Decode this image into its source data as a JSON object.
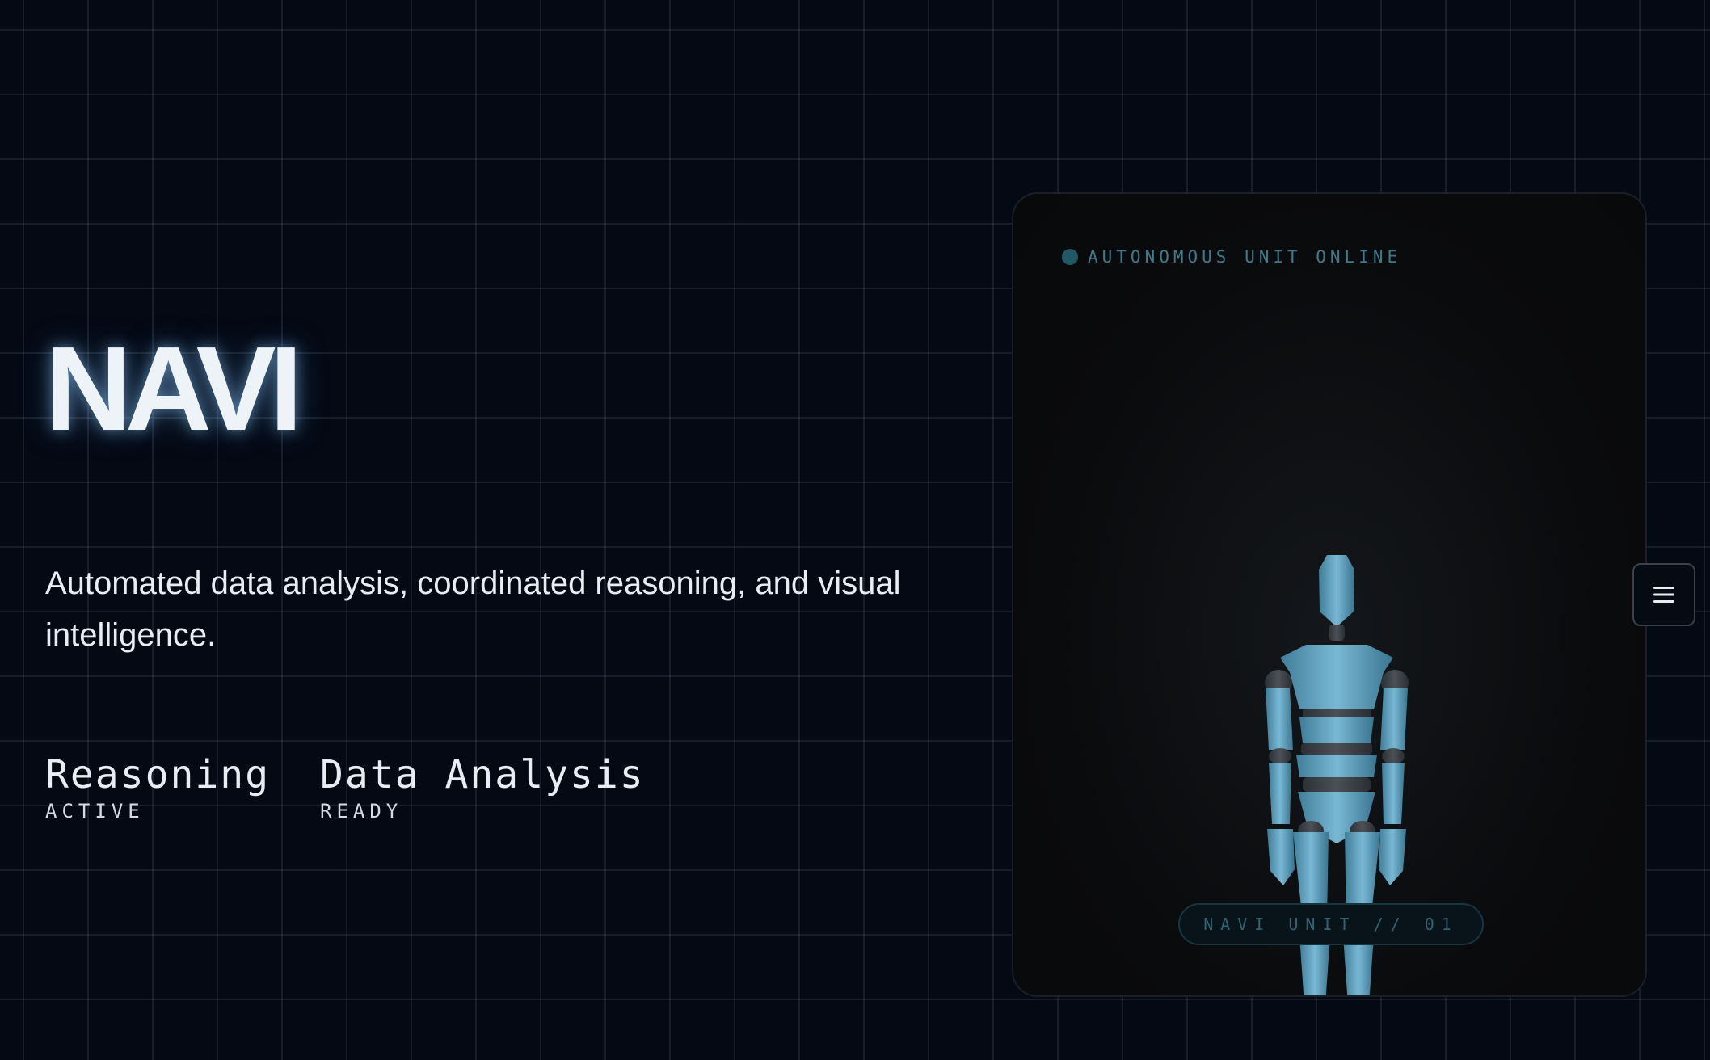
{
  "hero": {
    "title": "NAVI",
    "tagline": "Automated data analysis, coordinated reasoning, and visual intelligence."
  },
  "capabilities": [
    {
      "name": "Reasoning",
      "status": "ACTIVE"
    },
    {
      "name": "Data Analysis",
      "status": "READY"
    }
  ],
  "panel": {
    "status_text": "AUTONOMOUS UNIT ONLINE",
    "unit_label": "NAVI UNIT // 01",
    "image_icon": "robot-figure-icon"
  },
  "menu": {
    "icon": "hamburger-menu-icon"
  },
  "colors": {
    "background": "#040914",
    "accent": "#3d7b8c",
    "status_dot": "#215866",
    "robot": "#6aa8c4"
  }
}
